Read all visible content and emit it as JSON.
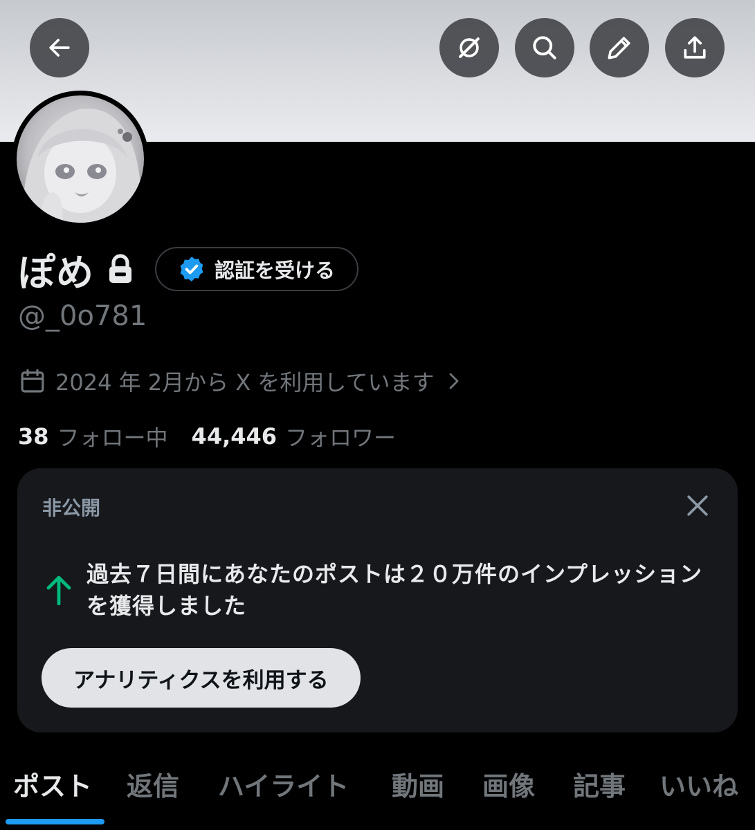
{
  "header": {
    "back_icon": "arrow-left-icon",
    "grok_icon": "grok-icon",
    "search_icon": "search-icon",
    "edit_icon": "pencil-icon",
    "share_icon": "share-icon"
  },
  "profile": {
    "display_name": "ぽめ",
    "lock_icon": "lock-icon",
    "verify_button_label": "認証を受ける",
    "verify_icon": "verified-badge-icon",
    "handle": "@_0o781",
    "joined_text": "2024 年 2月から X を利用しています",
    "following_count": "38",
    "following_label": "フォロー中",
    "followers_count": "44,446",
    "followers_label": "フォロワー"
  },
  "insight_card": {
    "label": "非公開",
    "message": "過去７日間にあなたのポストは２０万件のインプレッションを獲得しました",
    "button_label": "アナリティクスを利用する"
  },
  "tabs": [
    {
      "label": "ポスト",
      "active": true
    },
    {
      "label": "返信",
      "active": false
    },
    {
      "label": "ハイライト",
      "active": false
    },
    {
      "label": "動画",
      "active": false
    },
    {
      "label": "画像",
      "active": false
    },
    {
      "label": "記事",
      "active": false
    },
    {
      "label": "いいね",
      "active": false
    }
  ],
  "colors": {
    "accent": "#1d9bf0",
    "background": "#000000",
    "card": "#16181c",
    "secondary_text": "#71767b",
    "positive": "#00ba7c"
  }
}
